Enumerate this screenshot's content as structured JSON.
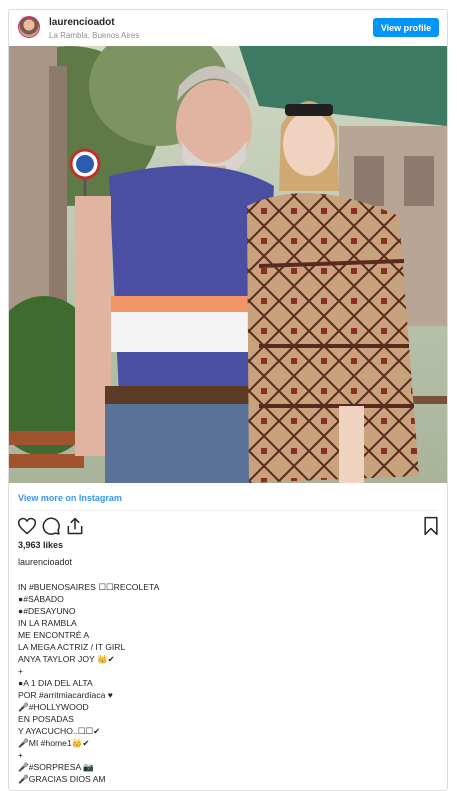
{
  "header": {
    "username": "laurencioadot",
    "location": "La Rambla, Buenos Aires",
    "view_profile_label": "View profile"
  },
  "post": {
    "view_more_label": "View more on Instagram",
    "likes": "3,963 likes",
    "caption_user": "laurencioadot",
    "caption_lines": [
      "IN #BUENOSAIRES ☐☐RECOLETA",
      "●#SÁBADO",
      "●#DESAYUNO",
      "IN LA RAMBLA",
      "ME ENCONTRÉ A",
      "LA MEGA ACTRIZ / IT GIRL",
      "ANYA TAYLOR JOY 👑✔",
      "+",
      "●A 1 DIA DEL ALTA",
      "POR #arritmiacardíaca ♥",
      "🎤#HOLLYWOOD",
      "EN POSADAS",
      "Y AYACUCHO..☐☐✔",
      "🎤MI #home1👑✔",
      "+",
      "🎤#SORPRESA 📷",
      "🎤GRACIAS DIOS AM"
    ]
  },
  "icons": {
    "like": "heart-icon",
    "comment": "comment-icon",
    "share": "share-icon",
    "save": "bookmark-icon",
    "accessibility_sign": "wheelchair-icon"
  },
  "colors": {
    "accent": "#0095f6",
    "link": "#3897f0",
    "border": "#dbdbdb",
    "muted": "#8e8e8e"
  }
}
